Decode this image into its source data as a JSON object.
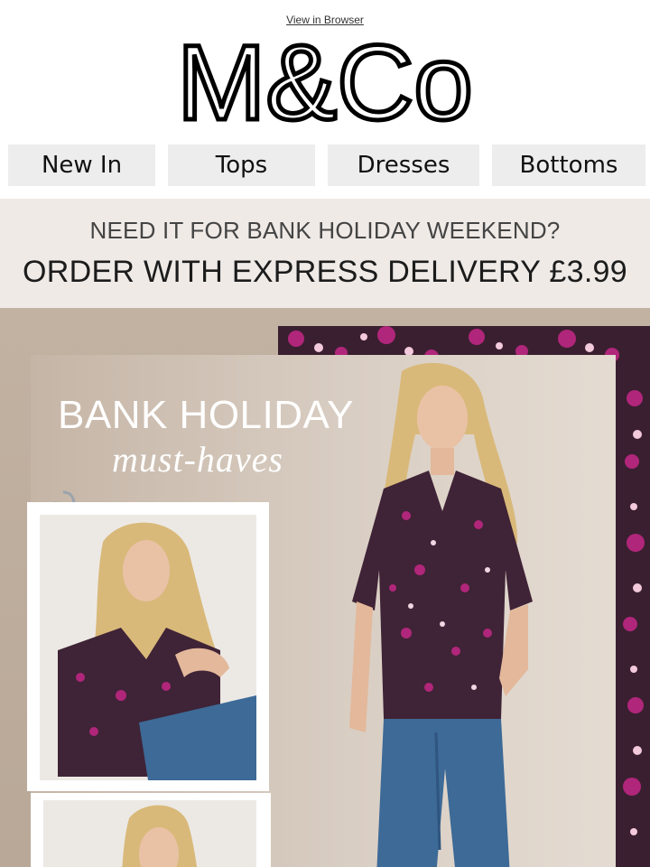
{
  "header": {
    "view_in_browser": "View in Browser",
    "brand": "M&Co"
  },
  "nav": {
    "items": [
      {
        "label": "New In"
      },
      {
        "label": "Tops"
      },
      {
        "label": "Dresses"
      },
      {
        "label": "Bottoms"
      }
    ]
  },
  "promo": {
    "line1": "NEED IT FOR BANK HOLIDAY WEEKEND?",
    "line2": "ORDER WITH EXPRESS DELIVERY £3.99"
  },
  "hero": {
    "title": "BANK HOLIDAY",
    "subtitle": "must-haves"
  },
  "colors": {
    "nav_bg": "#ededed",
    "promo_bg": "#efeae6",
    "hero_bg": "#c2b2a2",
    "print_base": "#3a1f30",
    "print_accent": "#b0267a",
    "denim": "#3d6a97"
  }
}
